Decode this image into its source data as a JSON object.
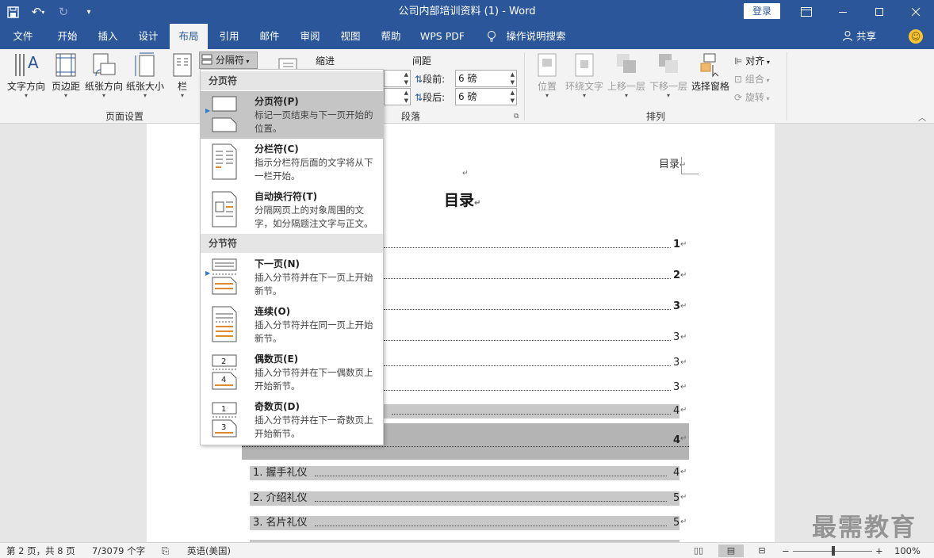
{
  "app": {
    "title": "公司内部培训资料 (1)  -  Word",
    "login": "登录"
  },
  "qat": {
    "save_icon": "save-icon",
    "undo_icon": "undo-icon",
    "redo_icon": "redo-icon"
  },
  "menu": {
    "tabs": [
      "文件",
      "开始",
      "插入",
      "设计",
      "布局",
      "引用",
      "邮件",
      "审阅",
      "视图",
      "帮助",
      "WPS PDF",
      "操作说明搜索"
    ],
    "active_tab": "布局",
    "share": "共享"
  },
  "ribbon": {
    "text_direction": "文字方向",
    "margins": "页边距",
    "orientation": "纸张方向",
    "size": "纸张大小",
    "columns": "栏",
    "breaks": "分隔符",
    "page_setup_group": "页面设置",
    "indent_label": "缩进",
    "spacing_label": "间距",
    "before_label": "段前:",
    "after_label": "段后:",
    "before_value": "6 磅",
    "after_value": "6 磅",
    "paragraph_group": "段落",
    "position": "位置",
    "wrap_text": "环绕文字",
    "bring_forward": "上移一层",
    "send_backward": "下移一层",
    "selection_pane": "选择窗格",
    "align": "对齐",
    "group": "组合",
    "rotate": "旋转",
    "arrange_group": "排列"
  },
  "dropdown": {
    "section_page_breaks": "分页符",
    "section_section_breaks": "分节符",
    "items": [
      {
        "title": "分页符(P)",
        "desc": "标记一页结束与下一页开始的位置。"
      },
      {
        "title": "分栏符(C)",
        "desc": "指示分栏符后面的文字将从下一栏开始。"
      },
      {
        "title": "自动换行符(T)",
        "desc": "分隔网页上的对象周围的文字，如分隔题注文字与正文。"
      },
      {
        "title": "下一页(N)",
        "desc": "插入分节符并在下一页上开始新节。"
      },
      {
        "title": "连续(O)",
        "desc": "插入分节符并在同一页上开始新节。"
      },
      {
        "title": "偶数页(E)",
        "desc": "插入分节符并在下一偶数页上开始新节。"
      },
      {
        "title": "奇数页(D)",
        "desc": "插入分节符并在下一奇数页上开始新节。"
      }
    ]
  },
  "document": {
    "header_text": "目录",
    "toc_title": "目录",
    "para_mark": "↵",
    "toc_pages": [
      "1",
      "2",
      "3",
      "3",
      "3",
      "3",
      "4",
      "4"
    ],
    "toc_entries": [
      {
        "text": "1.  握手礼仪",
        "page": "4"
      },
      {
        "text": "2.  介绍礼仪",
        "page": "5"
      },
      {
        "text": "3.  名片礼仪",
        "page": "5"
      }
    ]
  },
  "status": {
    "page": "第 2 页，共 8 页",
    "words": "7/3079 个字",
    "language": "英语(美国)",
    "zoom": "100%",
    "zoom_level": 100
  },
  "watermark": "最需教育"
}
